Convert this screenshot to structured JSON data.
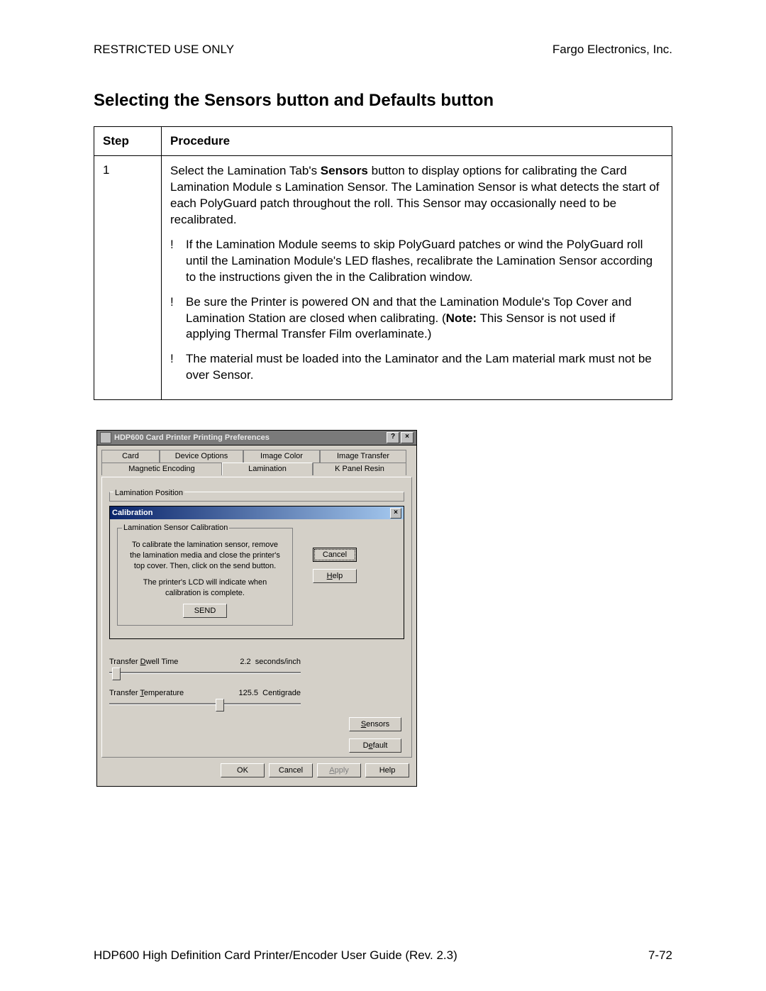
{
  "header": {
    "left": "RESTRICTED USE ONLY",
    "right": "Fargo Electronics, Inc."
  },
  "title": "Selecting the Sensors button and Defaults button",
  "table": {
    "head_step": "Step",
    "head_proc": "Procedure",
    "step_num": "1",
    "para1a": "Select the Lamination Tab's ",
    "para1b": "Sensors",
    "para1c": " button to display options for calibrating the Card Lamination Module s Lamination Sensor. The Lamination Sensor is what detects the start of each PolyGuard patch throughout the roll. This Sensor may occasionally need to be recalibrated.",
    "bullet_mark": "!",
    "bullet1": "If the Lamination Module seems to skip PolyGuard patches or wind the PolyGuard roll until the Lamination Module's LED flashes, recalibrate the Lamination Sensor according to the instructions given the in the Calibration window.",
    "bullet2a": "Be sure the Printer is powered ON and that the Lamination Module's Top Cover and Lamination Station are closed when calibrating. (",
    "bullet2b": "Note:",
    "bullet2c": " This Sensor is not used if applying Thermal Transfer Film overlaminate.)",
    "bullet3": "The material must be loaded into the Laminator and the Lam material mark must not be over Sensor."
  },
  "dialog": {
    "title": "HDP600 Card Printer Printing Preferences",
    "help_glyph": "?",
    "close_glyph": "×",
    "tabs_row1": [
      "Card",
      "Device Options",
      "Image Color",
      "Image Transfer"
    ],
    "tabs_row2": [
      "Magnetic Encoding",
      "Lamination",
      "K Panel Resin"
    ],
    "active_tab": "Lamination",
    "group_lp": "Lamination Position",
    "sub_title": "Calibration",
    "fieldset_legend": "Lamination Sensor Calibration",
    "calib_text1": "To calibrate the lamination sensor, remove the lamination media and close the printer's top cover. Then, click on the send button.",
    "calib_text2": "The printer's LCD will indicate when calibration is complete.",
    "send": "SEND",
    "cancel": "Cancel",
    "help": "Help",
    "help_u": "H",
    "dwell_label": "Transfer Dwell Time",
    "dwell_u": "D",
    "dwell_value": "2.2",
    "dwell_unit": "seconds/inch",
    "temp_label": "Transfer Temperature",
    "temp_u": "T",
    "temp_value": "125.5",
    "temp_unit": "Centigrade",
    "sensors": "Sensors",
    "sensors_u": "S",
    "default": "Default",
    "default_u": "e",
    "ok": "OK",
    "cancel2": "Cancel",
    "apply": "Apply",
    "apply_u": "A",
    "help2": "Help"
  },
  "footer": {
    "left": "HDP600 High Definition Card Printer/Encoder User Guide (Rev. 2.3)",
    "right": "7-72"
  }
}
